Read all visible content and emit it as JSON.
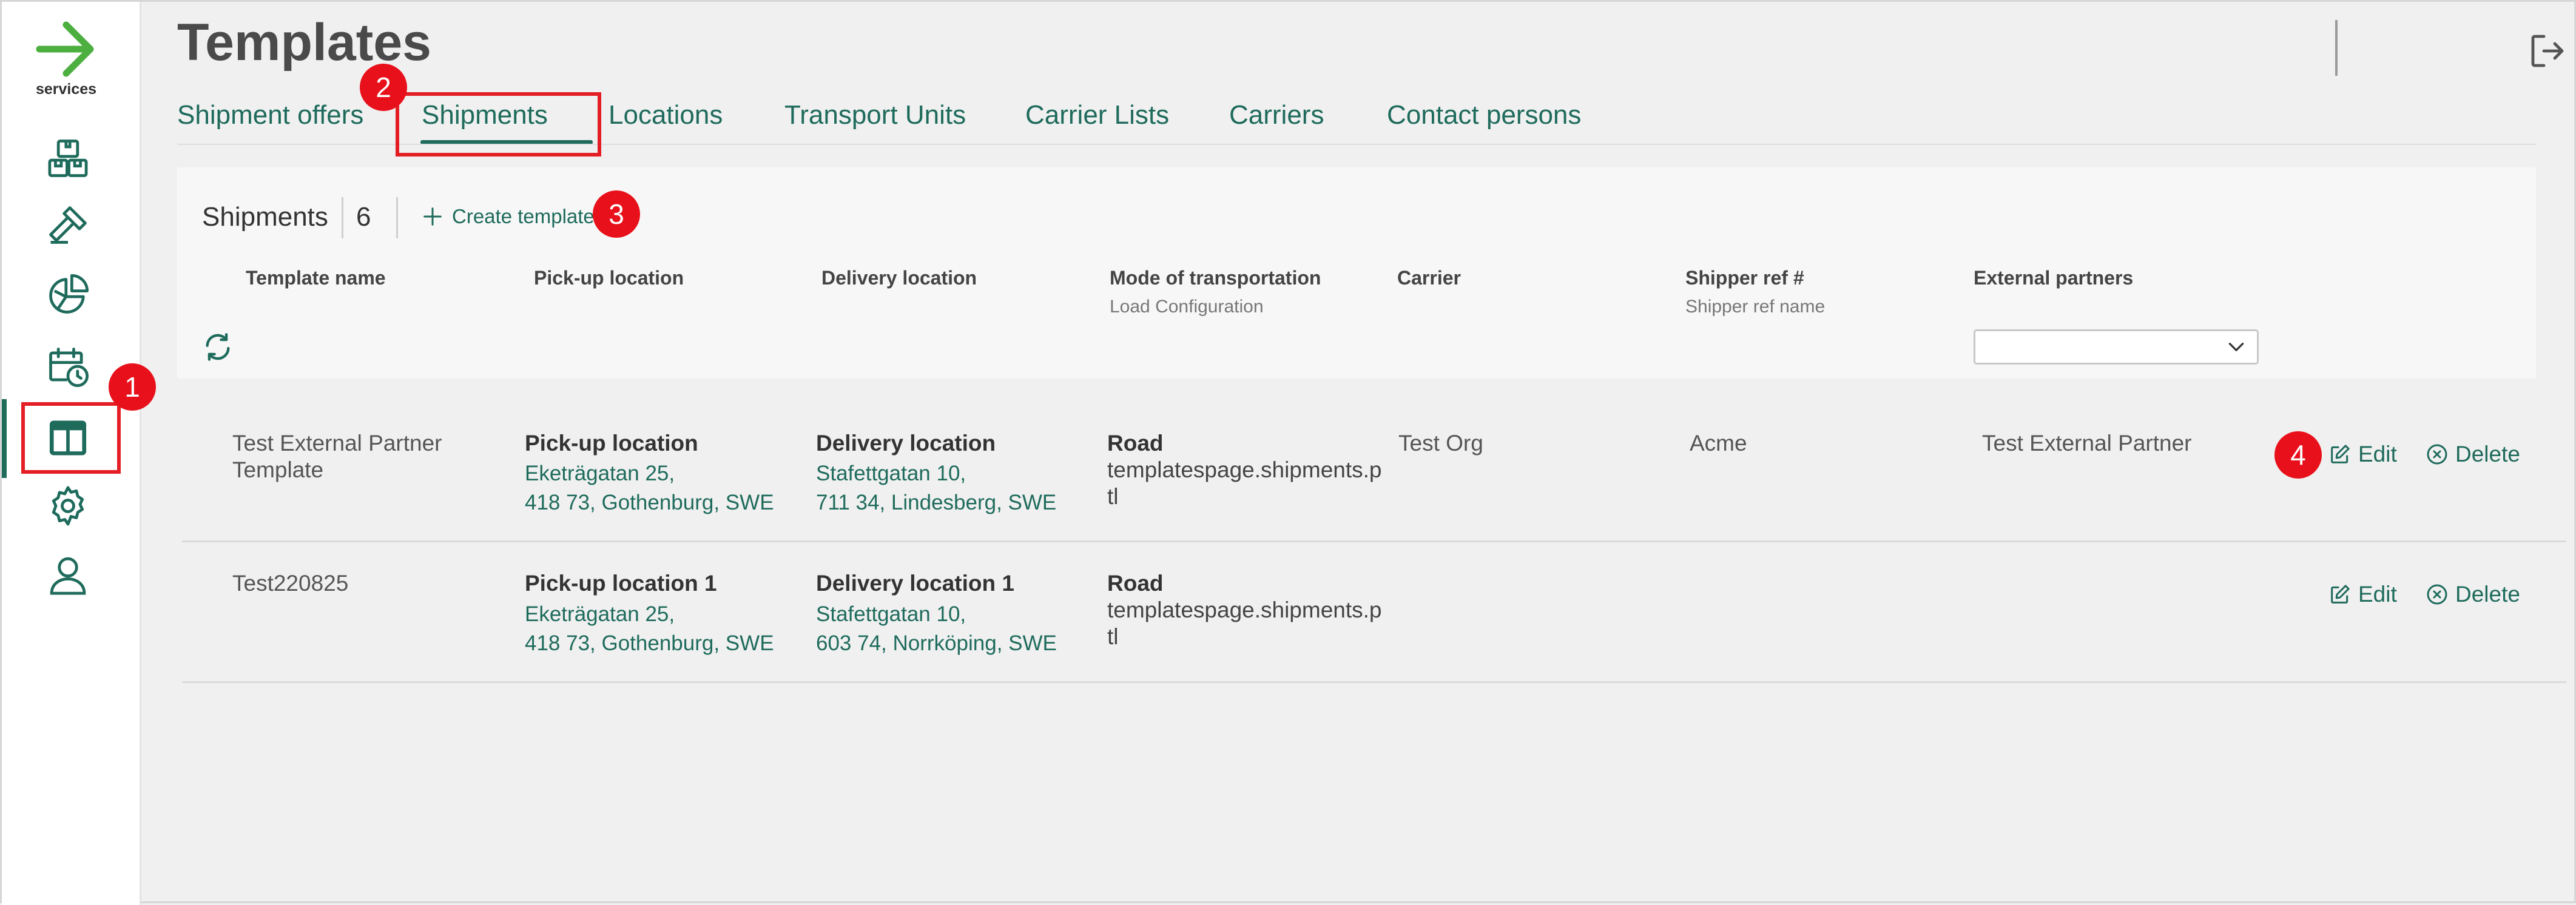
{
  "sidebar": {
    "logo_text": "services",
    "items": [
      {
        "icon": "boxes-icon"
      },
      {
        "icon": "gavel-icon"
      },
      {
        "icon": "pie-chart-icon"
      },
      {
        "icon": "calendar-clock-icon"
      },
      {
        "icon": "layout-icon",
        "active": true
      },
      {
        "icon": "gear-icon"
      },
      {
        "icon": "user-icon"
      }
    ]
  },
  "header": {
    "title": "Templates"
  },
  "tabs": [
    {
      "label": "Shipment offers"
    },
    {
      "label": "Shipments",
      "selected": true
    },
    {
      "label": "Locations"
    },
    {
      "label": "Transport Units"
    },
    {
      "label": "Carrier Lists"
    },
    {
      "label": "Carriers"
    },
    {
      "label": "Contact persons"
    }
  ],
  "panel": {
    "title": "Shipments",
    "count": "6",
    "create_label": "Create template"
  },
  "columns": {
    "template_name": "Template name",
    "pickup": "Pick-up location",
    "delivery": "Delivery location",
    "mode": "Mode of transportation",
    "mode_sub": "Load Configuration",
    "carrier": "Carrier",
    "shipper_ref": "Shipper ref #",
    "shipper_ref_sub": "Shipper ref name",
    "external": "External partners"
  },
  "filter": {
    "external_partners_value": ""
  },
  "rows": [
    {
      "name_line1": "Test External Partner",
      "name_line2": "Template",
      "pickup_title": "Pick-up location",
      "pickup_line1": "Eketrägatan 25,",
      "pickup_line2": "418 73, Gothenburg, SWE",
      "delivery_title": "Delivery location",
      "delivery_line1": "Stafettgatan 10,",
      "delivery_line2": "711 34, Lindesberg, SWE",
      "mode_title": "Road",
      "mode_line1": "templatespage.shipments.p",
      "mode_line2": "tl",
      "carrier": "Test Org",
      "shipper_ref": "Acme",
      "external": "Test External Partner",
      "edit_label": "Edit",
      "delete_label": "Delete"
    },
    {
      "name_line1": "Test220825",
      "name_line2": "",
      "pickup_title": "Pick-up location 1",
      "pickup_line1": "Eketrägatan 25,",
      "pickup_line2": "418 73, Gothenburg, SWE",
      "delivery_title": "Delivery location 1",
      "delivery_line1": "Stafettgatan 10,",
      "delivery_line2": "603 74, Norrköping, SWE",
      "mode_title": "Road",
      "mode_line1": "templatespage.shipments.p",
      "mode_line2": "tl",
      "carrier": "",
      "shipper_ref": "",
      "external": "",
      "edit_label": "Edit",
      "delete_label": "Delete"
    }
  ],
  "annotations": [
    "1",
    "2",
    "3",
    "4"
  ],
  "colors": {
    "accent": "#1e6b5c",
    "highlight": "#e31e25",
    "logo_green": "#4caf3f"
  }
}
